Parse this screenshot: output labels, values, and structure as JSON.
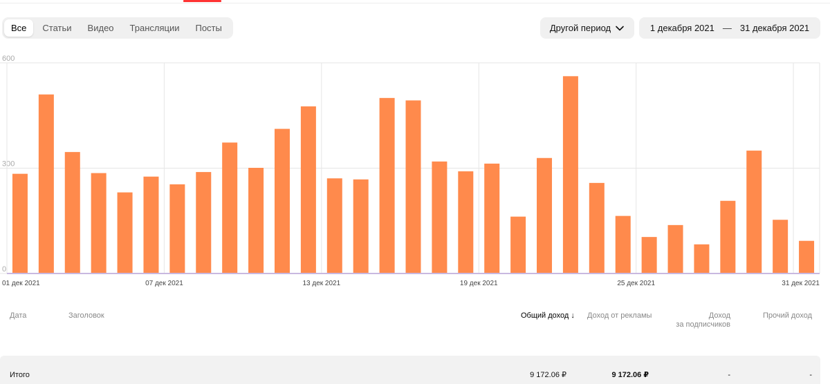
{
  "filter_tabs": [
    {
      "label": "Все",
      "active": true
    },
    {
      "label": "Статьи",
      "active": false
    },
    {
      "label": "Видео",
      "active": false
    },
    {
      "label": "Трансляции",
      "active": false
    },
    {
      "label": "Посты",
      "active": false
    }
  ],
  "period": {
    "label": "Другой период",
    "icon": "chevron-down-icon"
  },
  "date_range": {
    "from": "1 декабря 2021",
    "separator": "—",
    "to": "31 декабря 2021"
  },
  "colors": {
    "bar": "#ff8a4c",
    "accent": "#ff3333",
    "grid": "#e6e6e6",
    "baseline": "#c8b8e0"
  },
  "chart_data": {
    "type": "bar",
    "categories": [
      "01 дек 2021",
      "02 дек 2021",
      "03 дек 2021",
      "04 дек 2021",
      "05 дек 2021",
      "06 дек 2021",
      "07 дек 2021",
      "08 дек 2021",
      "09 дек 2021",
      "10 дек 2021",
      "11 дек 2021",
      "12 дек 2021",
      "13 дек 2021",
      "14 дек 2021",
      "15 дек 2021",
      "16 дек 2021",
      "17 дек 2021",
      "18 дек 2021",
      "19 дек 2021",
      "20 дек 2021",
      "21 дек 2021",
      "22 дек 2021",
      "23 дек 2021",
      "24 дек 2021",
      "25 дек 2021",
      "26 дек 2021",
      "27 дек 2021",
      "28 дек 2021",
      "29 дек 2021",
      "30 дек 2021",
      "31 дек 2021"
    ],
    "values": [
      284,
      510,
      346,
      286,
      231,
      276,
      254,
      289,
      373,
      301,
      412,
      476,
      271,
      268,
      500,
      493,
      319,
      291,
      313,
      162,
      329,
      562,
      258,
      164,
      104,
      138,
      83,
      207,
      350,
      153,
      93
    ],
    "ylim": [
      0,
      600
    ],
    "yticks": [
      "0",
      "300",
      "600"
    ],
    "xtick_labels": [
      "01 дек 2021",
      "07 дек 2021",
      "13 дек 2021",
      "19 дек 2021",
      "25 дек 2021",
      "31 дек 2021"
    ],
    "xtick_indices": [
      0,
      6,
      12,
      18,
      24,
      30
    ],
    "grid": true
  },
  "table": {
    "headers": {
      "date": "Дата",
      "title": "Заголовок",
      "total": "Общий доход ↓",
      "ads": "Доход от рекламы",
      "subs_line1": "Доход",
      "subs_line2": "за подписчиков",
      "other": "Прочий доход"
    },
    "total_row": {
      "label": "Итого",
      "total": "9 172.06 ₽",
      "ads": "9 172.06 ₽",
      "subs": "-",
      "other": "-"
    }
  }
}
